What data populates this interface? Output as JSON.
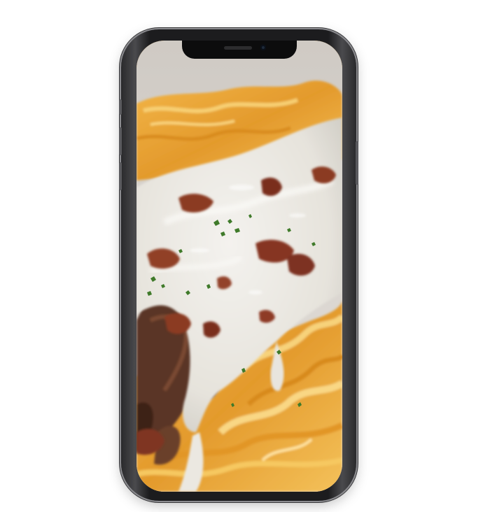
{
  "device": {
    "model": "phone-mockup"
  },
  "screen": {
    "content": "food-photo",
    "colors": {
      "pasta": "#e9a43a",
      "pasta_light": "#f6c25b",
      "sauce": "#ece9e2",
      "sauce_shadow": "#c9c6be",
      "bacon": "#8b3a24",
      "meat": "#5a3525",
      "herb": "#3f7a2a",
      "plate": "#d8d4cf"
    }
  }
}
